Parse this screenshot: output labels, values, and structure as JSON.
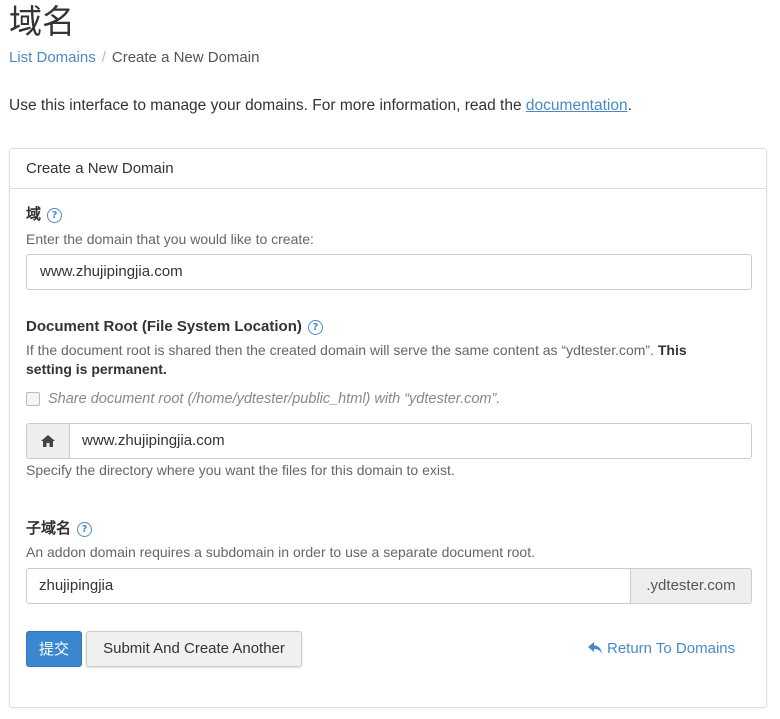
{
  "page": {
    "title": "域名"
  },
  "breadcrumb": {
    "parent": "List Domains",
    "separator": "/",
    "current": "Create a New Domain"
  },
  "intro": {
    "text": "Use this interface to manage your domains. For more information, read the ",
    "link": "documentation",
    "suffix": "."
  },
  "panel": {
    "heading": "Create a New Domain"
  },
  "domain": {
    "label": "域",
    "help_icon": "question-circle-icon",
    "hint": "Enter the domain that you would like to create:",
    "value": "www.zhujipingjia.com"
  },
  "docroot": {
    "label": "Document Root (File System Location)",
    "help_icon": "question-circle-icon",
    "note": "If the document root is shared then the created domain will serve the same content as “ydtester.com”. ",
    "note_bold": "This setting is permanent.",
    "share_label": "Share document root (/home/ydtester/public_html) with “ydtester.com”.",
    "share_checked": false,
    "home_icon": "home-icon",
    "value": "www.zhujipingjia.com",
    "hint": "Specify the directory where you want the files for this domain to exist."
  },
  "subdomain": {
    "label": "子域名",
    "help_icon": "question-circle-icon",
    "hint": "An addon domain requires a subdomain in order to use a separate document root.",
    "value": "zhujipingjia",
    "suffix": ".ydtester.com"
  },
  "actions": {
    "submit": "提交",
    "submit_another": "Submit And Create Another",
    "return_icon": "reply-arrow-icon",
    "return": "Return To Domains"
  },
  "colors": {
    "accent": "#3a87cf",
    "link": "#4b8ac7"
  }
}
